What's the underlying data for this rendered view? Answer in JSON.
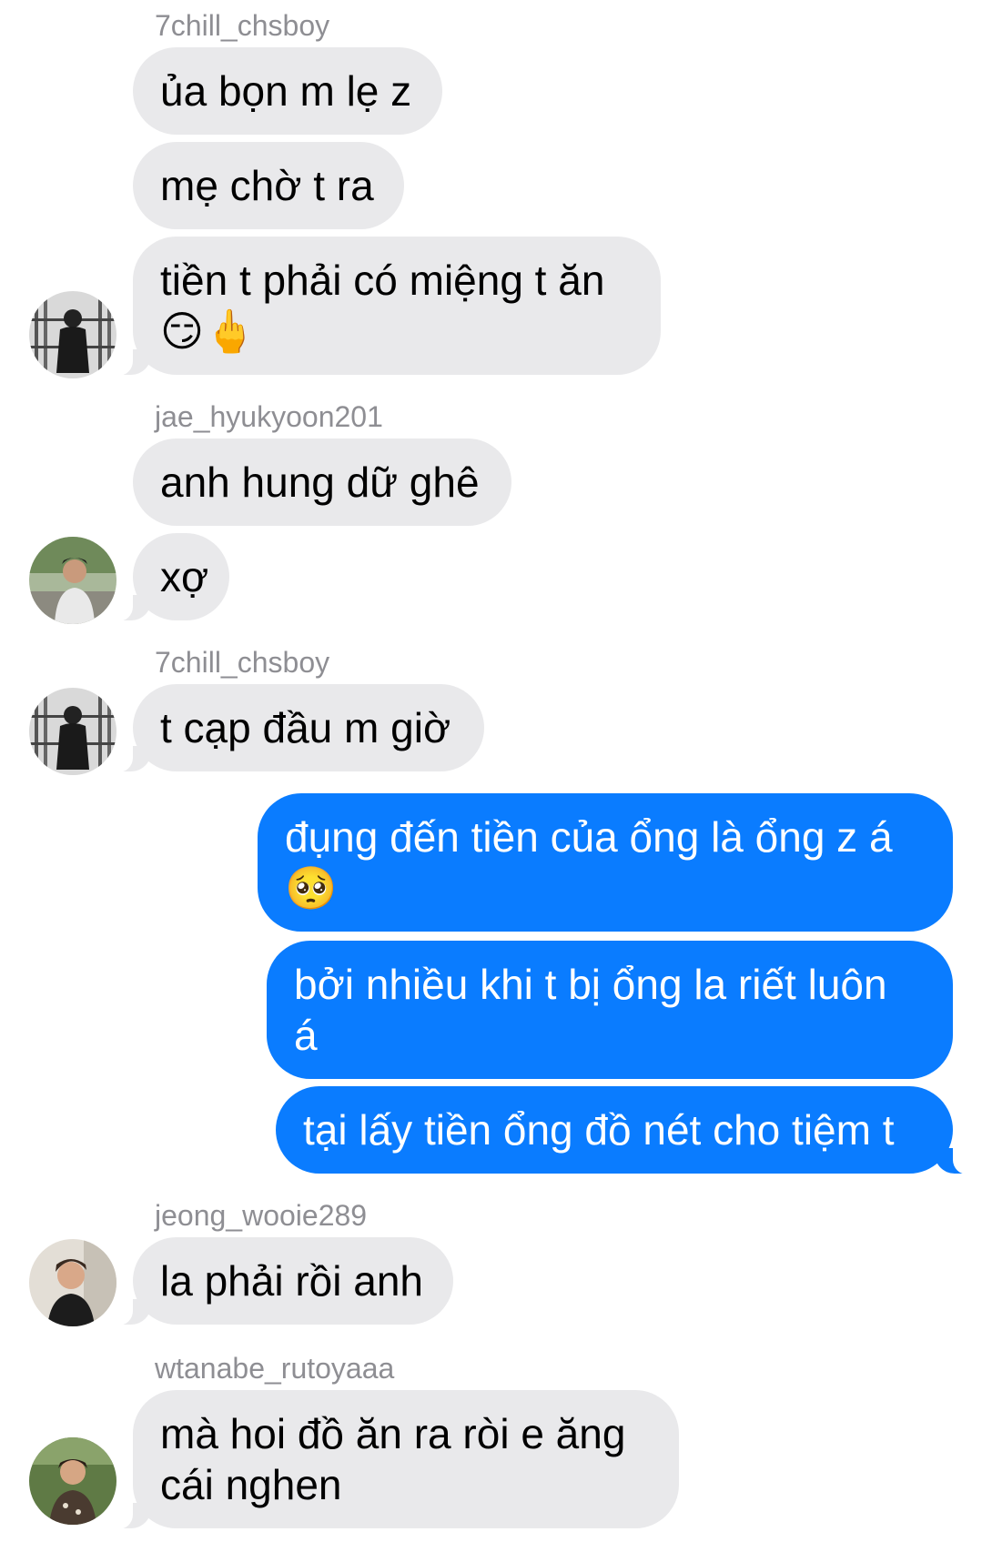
{
  "messages": [
    {
      "sender": "7chill_chsboy",
      "text": "ủa bọn m lẹ z"
    },
    {
      "text": "mẹ chờ t ra"
    },
    {
      "text": "tiền t phải có miệng t ăn",
      "emoji": "😏🖕"
    },
    {
      "sender": "jae_hyukyoon201",
      "text": "anh hung dữ ghê"
    },
    {
      "text": "xợ"
    },
    {
      "sender": "7chill_chsboy",
      "text": "t cạp đầu m giờ"
    },
    {
      "text": "đụng đến tiền của ổng là ổng z á",
      "emoji": "🥺"
    },
    {
      "text": "bởi nhiều khi t bị ổng la riết luôn",
      "text2": "á"
    },
    {
      "text": "tại lấy tiền ổng đồ nét cho tiệm t"
    },
    {
      "sender": "jeong_wooie289",
      "text": "la phải rồi anh"
    },
    {
      "sender": "wtanabe_rutoyaaa",
      "text": "mà hoi đồ ăn ra ròi e ăng",
      "text2": "cái nghen"
    }
  ]
}
